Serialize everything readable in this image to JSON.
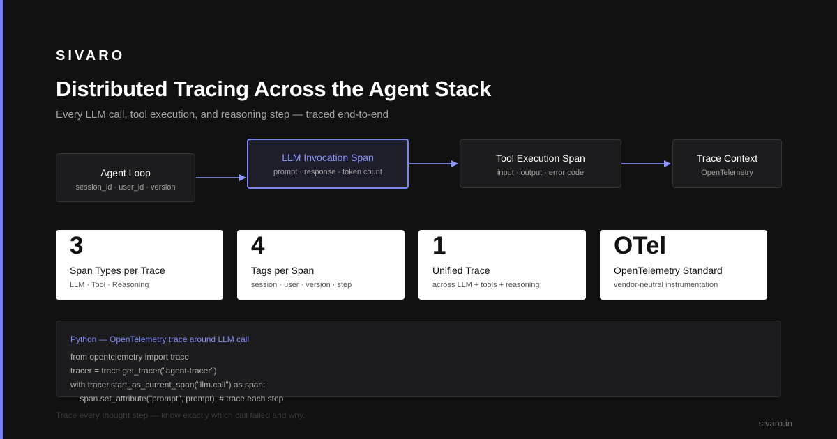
{
  "brand": {
    "name": "SIVARO"
  },
  "header": {
    "title": "Distributed Tracing Across the Agent Stack",
    "subtitle": "Every LLM call, tool execution, and reasoning step — traced end-to-end"
  },
  "flow": {
    "nodes": [
      {
        "title": "Agent Loop",
        "sub": "session_id · user_id · version"
      },
      {
        "title": "LLM Invocation Span",
        "sub": "prompt · response · token count",
        "highlighted": true
      },
      {
        "title": "Tool Execution Span",
        "sub": "input · output · error code"
      },
      {
        "title": "Trace Context",
        "sub": "OpenTelemetry"
      }
    ]
  },
  "stats": [
    {
      "value": "3",
      "label": "Span Types per Trace",
      "sub": "LLM · Tool · Reasoning"
    },
    {
      "value": "4",
      "label": "Tags per Span",
      "sub": "session · user · version · step"
    },
    {
      "value": "1",
      "label": "Unified Trace",
      "sub": "across LLM + tools + reasoning"
    },
    {
      "value": "OTel",
      "label": "OpenTelemetry Standard",
      "sub": "vendor-neutral instrumentation"
    }
  ],
  "code": {
    "title": "Python — OpenTelemetry trace around LLM call",
    "lines": [
      "from opentelemetry import trace",
      "tracer = trace.get_tracer(\"agent-tracer\")",
      "with tracer.start_as_current_span(\"llm.call\") as span:",
      "    span.set_attribute(\"prompt\", prompt)  # trace each step"
    ]
  },
  "footer": {
    "note": "Trace every thought step — know exactly which call failed and why.",
    "url": "sivaro.in"
  },
  "colors": {
    "background": "#111111",
    "accent": "#6f7cf0",
    "card": "#ffffff",
    "panel": "#1c1c1e"
  }
}
